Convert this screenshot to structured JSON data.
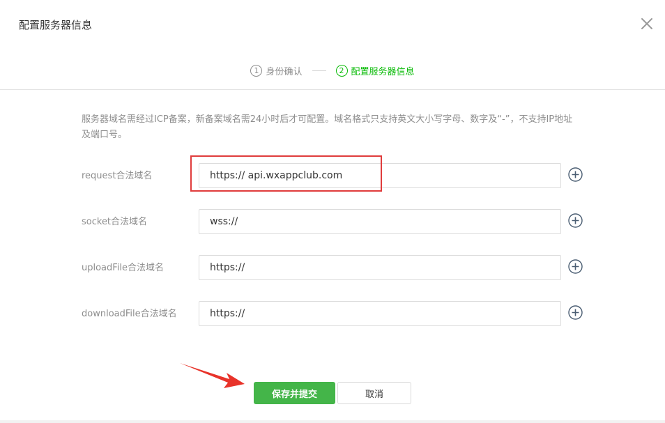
{
  "dialog": {
    "title": "配置服务器信息"
  },
  "steps": [
    {
      "num": "1",
      "label": "身份确认",
      "active": false
    },
    {
      "num": "2",
      "label": "配置服务器信息",
      "active": true
    }
  ],
  "tip": "服务器域名需经过ICP备案，新备案域名需24小时后才可配置。域名格式只支持英文大小写字母、数字及“-”，不支持IP地址及端口号。",
  "fields": {
    "request": {
      "label": "request合法域名",
      "value": "https:// api.wxappclub.com"
    },
    "socket": {
      "label": "socket合法域名",
      "value": "wss://"
    },
    "upload": {
      "label": "uploadFile合法域名",
      "value": "https://"
    },
    "download": {
      "label": "downloadFile合法域名",
      "value": "https://"
    }
  },
  "buttons": {
    "submit": "保存并提交",
    "cancel": "取消"
  },
  "colors": {
    "accent": "#44b549",
    "step_active": "#09bb07",
    "highlight": "#e03c3c"
  },
  "icons": {
    "close": "close-icon",
    "add": "plus-circle-icon",
    "annotation": "red-arrow-icon"
  }
}
